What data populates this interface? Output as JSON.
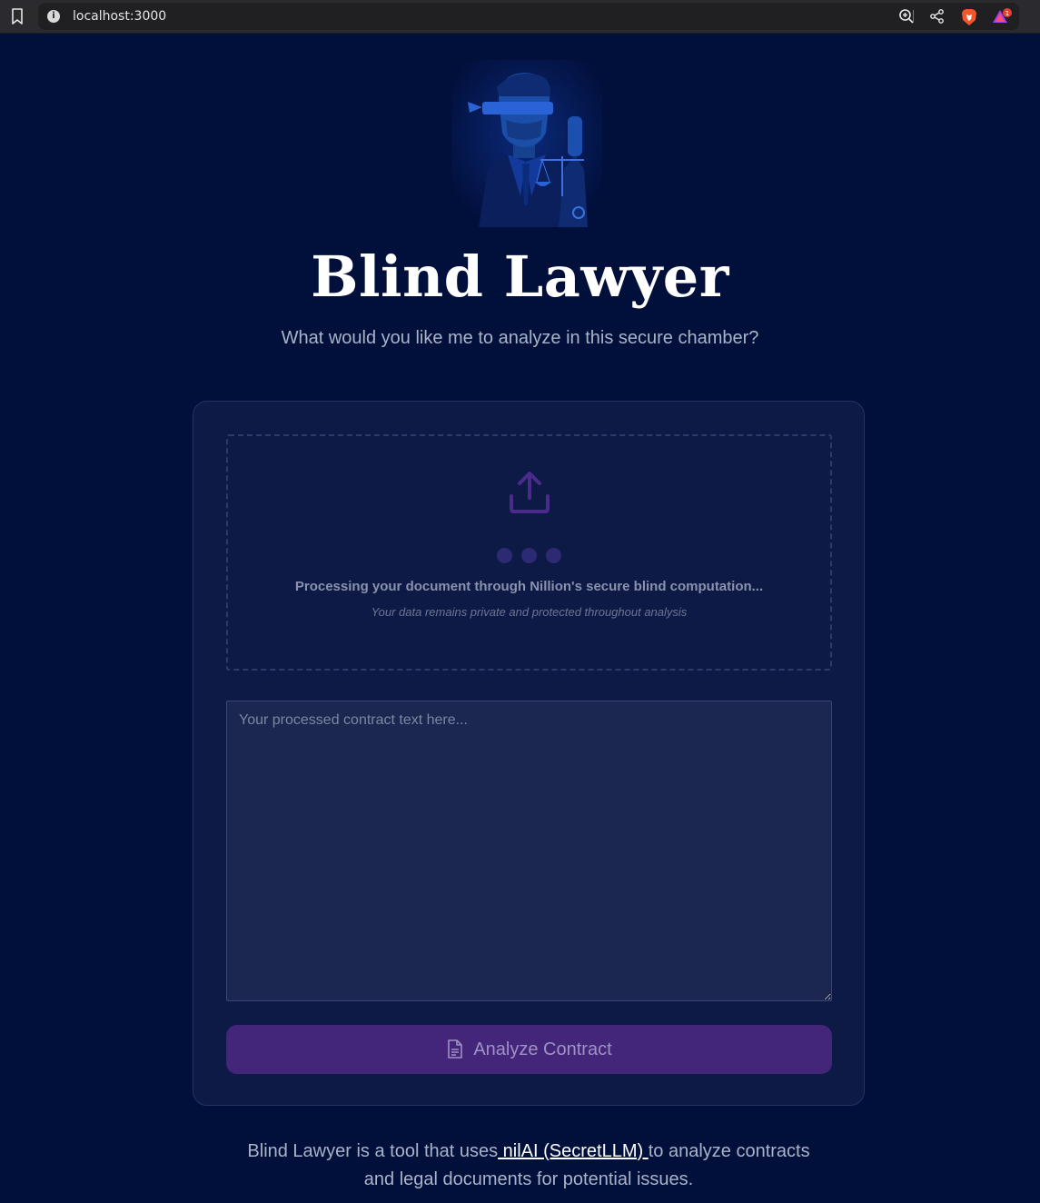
{
  "browser": {
    "url": "localhost:3000",
    "info_icon": "info-icon",
    "bookmark_icon": "bookmark-icon",
    "zoom_icon": "zoom-icon",
    "share_icon": "share-icon",
    "brave_icon": "brave-shield-icon",
    "rewards_icon": "brave-rewards-icon",
    "rewards_badge": "1"
  },
  "hero": {
    "title": "Blind Lawyer",
    "subtitle": "What would you like me to analyze in this secure chamber?",
    "logo_icon": "blindfolded-robot-lawyer-logo"
  },
  "upload": {
    "icon": "upload-icon",
    "processing_text": "Processing your document through Nillion's secure blind computation...",
    "privacy_text": "Your data remains private and protected throughout analysis"
  },
  "contract": {
    "placeholder": "Your processed contract text here...",
    "value": ""
  },
  "analyze_button": {
    "label": "Analyze Contract",
    "icon": "document-icon"
  },
  "footer": {
    "text_before": "Blind Lawyer is a tool that uses",
    "link_text": " nilAI (SecretLLM) ",
    "text_after": "to analyze contracts and legal documents for potential issues."
  },
  "colors": {
    "background": "#010f3b",
    "card": "#0d1a46",
    "accent": "#43257a",
    "upload_icon": "#4b2a8c"
  }
}
